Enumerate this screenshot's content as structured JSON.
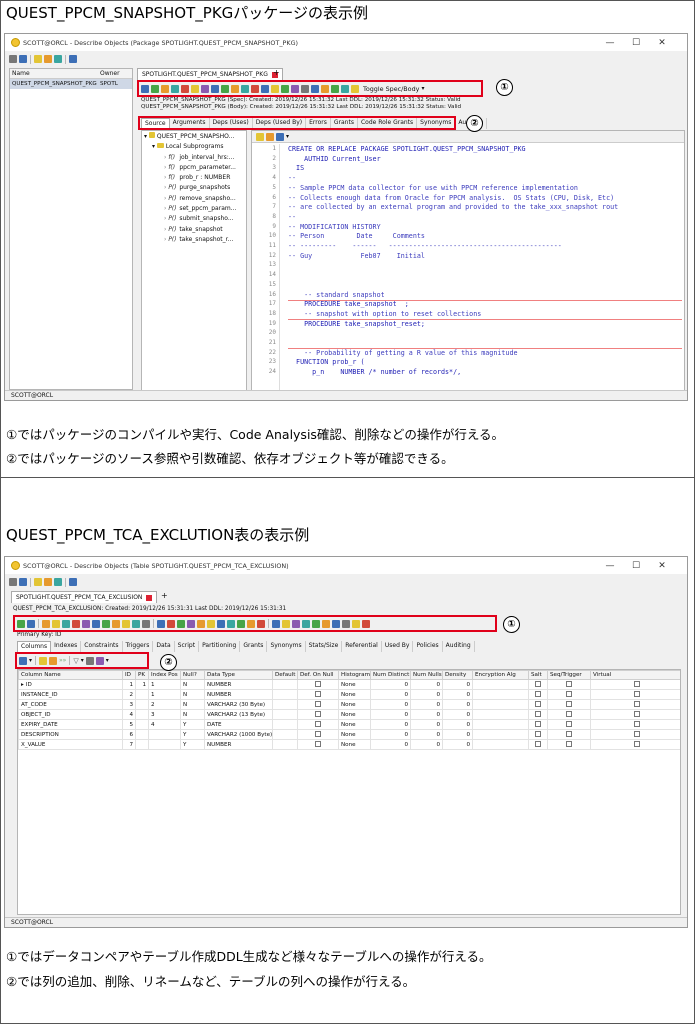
{
  "section1": {
    "heading": "QUEST_PPCM_SNAPSHOT_PKGパッケージの表示例",
    "window_title": "SCOTT@ORCL - Describe Objects (Package SPOTLIGHT.QUEST_PPCM_SNAPSHOT_PKG)",
    "left_list": {
      "col_name": "Name",
      "col_owner": "Owner",
      "row_name": "QUEST_PPCM_SNAPSHOT_PKG",
      "row_owner": "SPOTL"
    },
    "doc_tab": "SPOTLIGHT.QUEST_PPCM_SNAPSHOT_PKG",
    "toggle_label": "Toggle Spec/Body",
    "spec_info": "QUEST_PPCM_SNAPSHOT_PKG (Spec):   Created: 2019/12/26 15:31:32   Last DDL: 2019/12/26 15:31:32   Status: Valid",
    "body_info": "QUEST_PPCM_SNAPSHOT_PKG (Body):   Created: 2019/12/26 15:31:32   Last DDL: 2019/12/26 15:31:32   Status: Valid",
    "tabs": [
      "Source",
      "Arguments",
      "Deps (Uses)",
      "Deps (Used By)",
      "Errors",
      "Grants",
      "Code Role Grants",
      "Synonyms",
      "Auditing"
    ],
    "tree": {
      "root": "QUEST_PPCM_SNAPSHO...",
      "folder": "Local Subprograms",
      "items": [
        {
          "prefix": "f()",
          "label": "job_interval_hrs:..."
        },
        {
          "prefix": "f()",
          "label": "ppcm_parameter..."
        },
        {
          "prefix": "f()",
          "label": "prob_r : NUMBER"
        },
        {
          "prefix": "P()",
          "label": "purge_snapshots"
        },
        {
          "prefix": "P()",
          "label": "remove_snapsho..."
        },
        {
          "prefix": "P()",
          "label": "set_ppcm_param..."
        },
        {
          "prefix": "P()",
          "label": "submit_snapsho..."
        },
        {
          "prefix": "P()",
          "label": "take_snapshot"
        },
        {
          "prefix": "P()",
          "label": "take_snapshot_r..."
        }
      ]
    },
    "code_lines": [
      {
        "n": "1",
        "t": "CREATE OR REPLACE PACKAGE SPOTLIGHT.QUEST_PPCM_SNAPSHOT_PKG"
      },
      {
        "n": "2",
        "t": "    AUTHID Current_User"
      },
      {
        "n": "3",
        "t": "  IS"
      },
      {
        "n": "4",
        "t": "--"
      },
      {
        "n": "5",
        "t": "-- Sample PPCM data collector for use with PPCM reference implementation"
      },
      {
        "n": "6",
        "t": "-- Collects enough data from Oracle for PPCM analysis.  OS Stats (CPU, Disk, Etc)"
      },
      {
        "n": "7",
        "t": "-- are collected by an external program and provided to the take_xxx_snapshot rout"
      },
      {
        "n": "8",
        "t": "--"
      },
      {
        "n": "9",
        "t": "-- MODIFICATION HISTORY"
      },
      {
        "n": "10",
        "t": "-- Person        Date     Comments"
      },
      {
        "n": "11",
        "t": "-- ---------    ------   -------------------------------------------"
      },
      {
        "n": "12",
        "t": "-- Guy            Feb07    Initial"
      },
      {
        "n": "13",
        "t": ""
      },
      {
        "n": "14",
        "t": ""
      },
      {
        "n": "15",
        "t": ""
      },
      {
        "n": "16",
        "t": "    -- standard snapshot"
      },
      {
        "n": "17",
        "t": "    PROCEDURE take_snapshot  ;"
      },
      {
        "n": "18",
        "t": "    -- snapshot with option to reset collections"
      },
      {
        "n": "19",
        "t": "    PROCEDURE take_snapshot_reset;"
      },
      {
        "n": "20",
        "t": ""
      },
      {
        "n": "21",
        "t": ""
      },
      {
        "n": "22",
        "t": "    -- Probability of getting a R value of this magnitude"
      },
      {
        "n": "23",
        "t": "  FUNCTION prob_r ("
      },
      {
        "n": "24",
        "t": "      p_n    NUMBER /* number of records*/,"
      }
    ],
    "status": "SCOTT@ORCL",
    "note1": "①ではパッケージのコンパイルや実行、Code Analysis確認、削除などの操作が行える。",
    "note2": "②ではパッケージのソース参照や引数確認、依存オブジェクト等が確認できる。"
  },
  "section2": {
    "heading": "QUEST_PPCM_TCA_EXCLUTION表の表示例",
    "window_title": "SCOTT@ORCL - Describe Objects (Table SPOTLIGHT.QUEST_PPCM_TCA_EXCLUSION)",
    "doc_tab": "SPOTLIGHT.QUEST_PPCM_TCA_EXCLUSION",
    "info": "QUEST_PPCM_TCA_EXCLUSION:   Created: 2019/12/26 15:31:31   Last DDL: 2019/12/26 15:31:31",
    "primary_key": "Primary Key:  ID",
    "tabs": [
      "Columns",
      "Indexes",
      "Constraints",
      "Triggers",
      "Data",
      "Script",
      "Partitioning",
      "Grants",
      "Synonyms",
      "Stats/Size",
      "Referential",
      "Used By",
      "Policies",
      "Auditing"
    ],
    "headers": [
      "Column Name",
      "ID",
      "PK",
      "Index Pos",
      "Null?",
      "Data Type",
      "Default",
      "Def. On Null",
      "Histogram",
      "Num Distinct",
      "Num Nulls",
      "Density",
      "Encryption Alg",
      "Salt",
      "Seq/Trigger",
      "Virtual"
    ],
    "rows": [
      {
        "name": "ID",
        "id": "1",
        "pk": "1",
        "ipos": "1",
        "null": "N",
        "type": "NUMBER",
        "hist": "None",
        "nd": "0",
        "nn": "0",
        "den": "0"
      },
      {
        "name": "INSTANCE_ID",
        "id": "2",
        "pk": "",
        "ipos": "1",
        "null": "N",
        "type": "NUMBER",
        "hist": "None",
        "nd": "0",
        "nn": "0",
        "den": "0"
      },
      {
        "name": "AT_CODE",
        "id": "3",
        "pk": "",
        "ipos": "2",
        "null": "N",
        "type": "VARCHAR2 (30 Byte)",
        "hist": "None",
        "nd": "0",
        "nn": "0",
        "den": "0"
      },
      {
        "name": "OBJECT_ID",
        "id": "4",
        "pk": "",
        "ipos": "3",
        "null": "N",
        "type": "VARCHAR2 (13 Byte)",
        "hist": "None",
        "nd": "0",
        "nn": "0",
        "den": "0"
      },
      {
        "name": "EXPIRY_DATE",
        "id": "5",
        "pk": "",
        "ipos": "4",
        "null": "Y",
        "type": "DATE",
        "hist": "None",
        "nd": "0",
        "nn": "0",
        "den": "0"
      },
      {
        "name": "DESCRIPTION",
        "id": "6",
        "pk": "",
        "ipos": "",
        "null": "Y",
        "type": "VARCHAR2 (1000 Byte)",
        "hist": "None",
        "nd": "0",
        "nn": "0",
        "den": "0"
      },
      {
        "name": "X_VALUE",
        "id": "7",
        "pk": "",
        "ipos": "",
        "null": "Y",
        "type": "NUMBER",
        "hist": "None",
        "nd": "0",
        "nn": "0",
        "den": "0"
      }
    ],
    "status": "SCOTT@ORCL",
    "note1": "①ではデータコンペアやテーブル作成DDL生成など様々なテーブルへの操作が行える。",
    "note2": "②では列の追加、削除、リネームなど、テーブルの列への操作が行える。"
  },
  "markers": {
    "one": "①",
    "two": "②"
  }
}
